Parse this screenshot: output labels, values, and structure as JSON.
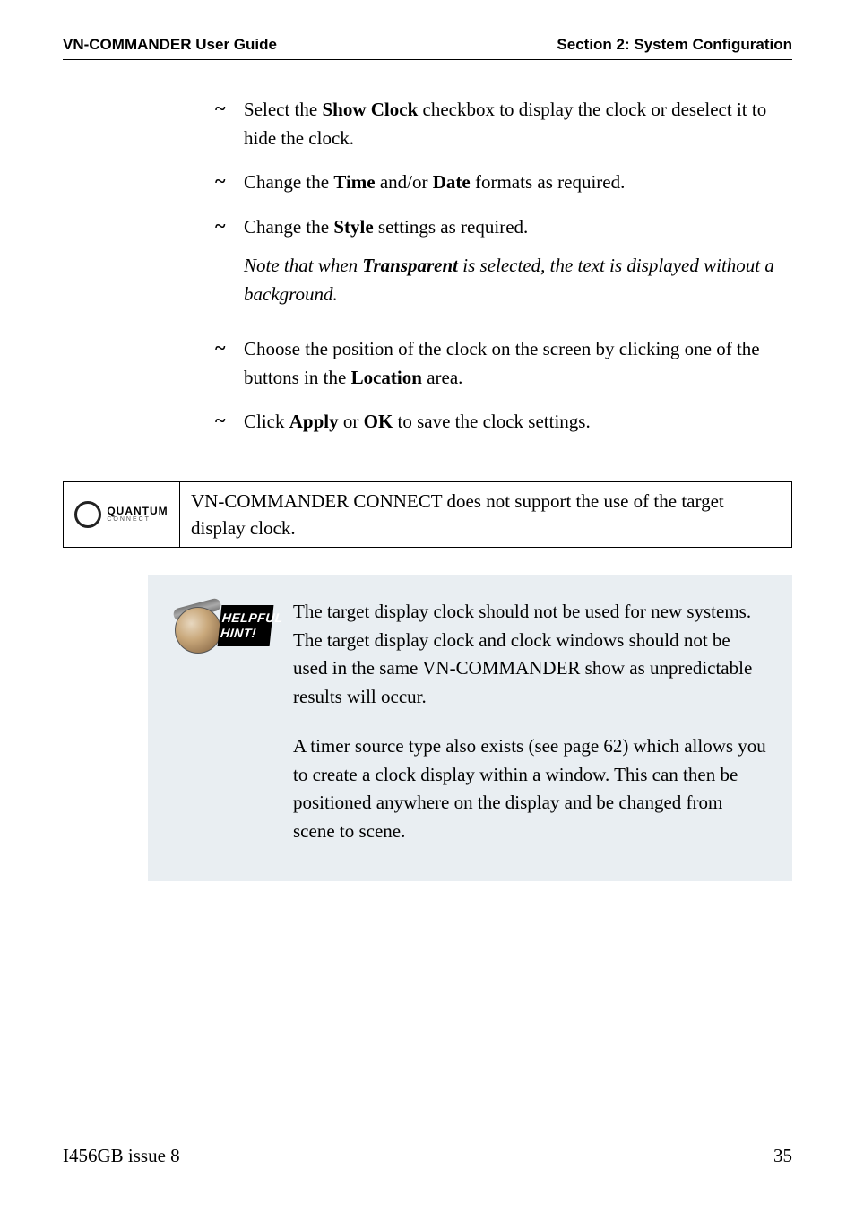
{
  "header": {
    "left": "VN-COMMANDER User Guide",
    "right": "Section 2: System Configuration"
  },
  "bullets": {
    "marker": "~",
    "items": [
      {
        "pre": "Select the ",
        "bold1": "Show Clock",
        "post": " checkbox to display the clock or deselect it to hide the clock."
      },
      {
        "pre": "Change the ",
        "bold1": "Time",
        "mid1": " and/or ",
        "bold2": "Date",
        "post": " formats as required."
      },
      {
        "pre": "Change the ",
        "bold1": "Style",
        "post": " settings as required.",
        "note_pre": "Note that when ",
        "note_bold": "Transparent",
        "note_post": " is selected, the text is displayed without a background."
      },
      {
        "pre": "Choose the position of the clock on the screen by clicking one of the buttons in the ",
        "bold1": "Location",
        "post": " area."
      },
      {
        "pre": "Click ",
        "bold1": "Apply",
        "mid1": " or ",
        "bold2": "OK",
        "post": " to save the clock settings."
      }
    ]
  },
  "quantum": {
    "logo_main": "QUANTUM",
    "logo_sub": "CONNECT",
    "text": "VN-COMMANDER CONNECT does not support the use of the target display clock."
  },
  "hint": {
    "label1": "HELPFUL",
    "label2": "HINT!",
    "para1": "The target display clock should not be used for new systems. The target display clock and clock windows should not be used in the same VN-COMMANDER show as unpredictable results will occur.",
    "para2": "A timer source type also exists (see page 62) which allows you to create a clock display within a window. This can then be positioned anywhere on the display and be changed from scene to scene."
  },
  "footer": {
    "left": "I456GB issue 8",
    "right": "35"
  }
}
